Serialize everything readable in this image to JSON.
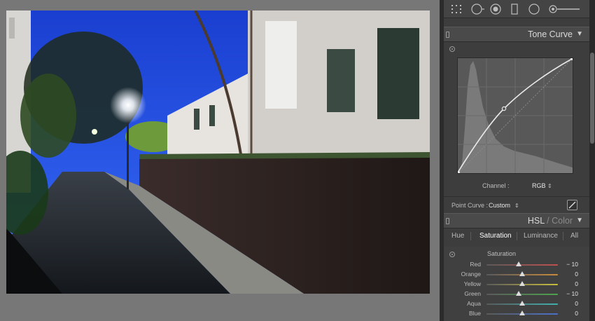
{
  "tool_strip": {
    "icons": [
      "grid-overlay-icon",
      "crop-icon",
      "spot-removal-icon",
      "graduated-filter-icon",
      "radial-filter-icon",
      "adjustment-brush-icon"
    ]
  },
  "tone_curve": {
    "title": "Tone Curve",
    "channel_label": "Channel :",
    "channel_value": "RGB",
    "point_curve_label": "Point Curve :",
    "point_curve_value": "Custom"
  },
  "hsl": {
    "title_hsl": "HSL",
    "title_sep": " / ",
    "title_color": "Color",
    "tabs": [
      "Hue",
      "Saturation",
      "Luminance",
      "All"
    ],
    "active_tab": "Saturation",
    "group_label": "Saturation",
    "sliders": [
      {
        "name": "Red",
        "value": "− 10",
        "num": -10,
        "track_color": "#c0504d"
      },
      {
        "name": "Orange",
        "value": "0",
        "num": 0,
        "track_color": "#c98a3e"
      },
      {
        "name": "Yellow",
        "value": "0",
        "num": 0,
        "track_color": "#c8bd3e"
      },
      {
        "name": "Green",
        "value": "− 10",
        "num": -10,
        "track_color": "#4ea34e"
      },
      {
        "name": "Aqua",
        "value": "0",
        "num": 0,
        "track_color": "#3fb0ad"
      },
      {
        "name": "Blue",
        "value": "0",
        "num": 0,
        "track_color": "#4a72c9"
      }
    ]
  },
  "colors": {
    "panel_bg": "#3d3d3d",
    "canvas_bg": "#777777",
    "header_bg": "#4a4a4a"
  }
}
